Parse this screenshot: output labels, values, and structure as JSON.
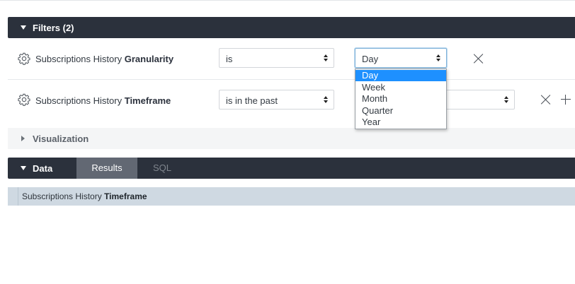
{
  "filters_section": {
    "title": "Filters (2)",
    "rows": [
      {
        "label_prefix": "Subscriptions History",
        "label_field": "Granularity",
        "operator": "is",
        "value": "Day"
      },
      {
        "label_prefix": "Subscriptions History",
        "label_field": "Timeframe",
        "operator": "is in the past",
        "value": ""
      }
    ]
  },
  "visualization": {
    "label": "Visualization"
  },
  "data_section": {
    "title": "Data",
    "tabs": [
      {
        "label": "Results",
        "active": true
      },
      {
        "label": "SQL",
        "active": false
      }
    ]
  },
  "results_table": {
    "column_prefix": "Subscriptions History",
    "column_field": "Timeframe"
  },
  "granularity_dropdown": {
    "options": [
      "Day",
      "Week",
      "Month",
      "Quarter",
      "Year"
    ],
    "selected": "Day",
    "highlight_color": "#1e90ff"
  },
  "colors": {
    "header_bg": "#2b313c",
    "active_tab_bg": "#626873",
    "column_header_bg": "#cfd9e2"
  }
}
